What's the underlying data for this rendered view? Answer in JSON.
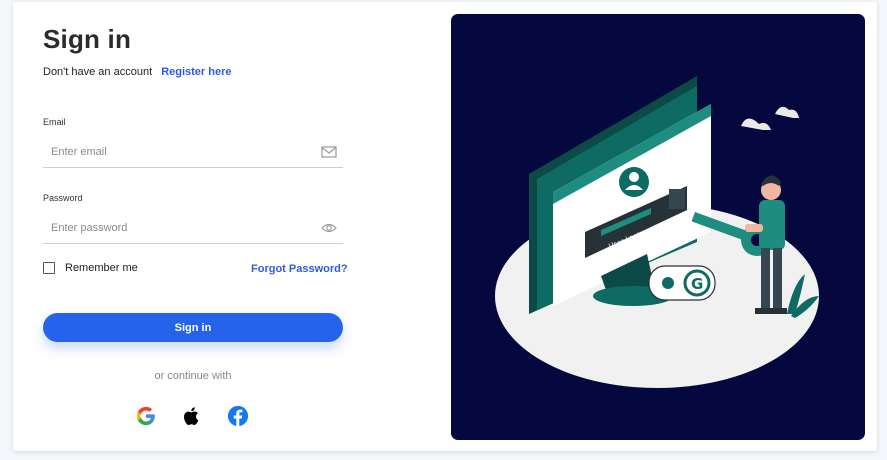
{
  "signin": {
    "title": "Sign in",
    "register_prompt": "Don't have an account",
    "register_link": "Register here",
    "email_label": "Email",
    "email_placeholder": "Enter email",
    "password_label": "Password",
    "password_placeholder": "Enter password",
    "remember_label": "Remember me",
    "forgot_link": "Forgot Password?",
    "submit_label": "Sign in",
    "continue_text": "or continue with"
  },
  "social": [
    {
      "icon": "google-icon"
    },
    {
      "icon": "apple-icon"
    },
    {
      "icon": "facebook-icon"
    }
  ],
  "illustration": {
    "screen_text": "User Login",
    "badge_letter": "G"
  },
  "colors": {
    "accent": "#2563eb",
    "link": "#2d5be3",
    "panel_bg": "#05073f",
    "teal": "#0e6b63",
    "teal_light": "#1e8c7f"
  }
}
